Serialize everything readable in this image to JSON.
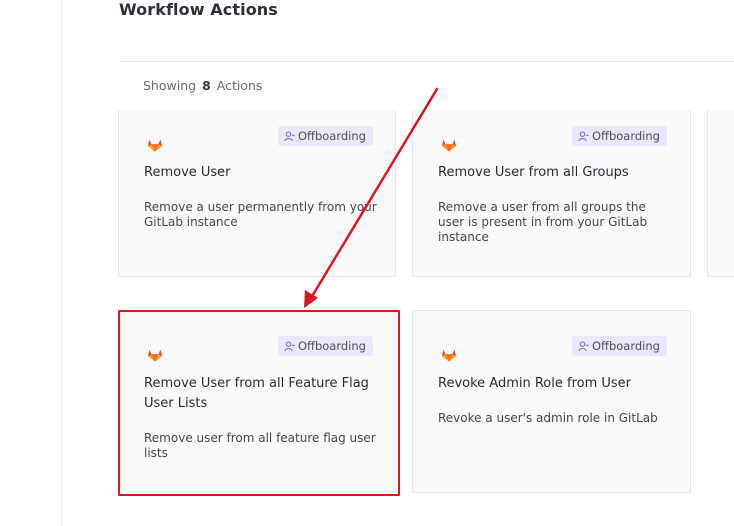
{
  "header": {
    "title": "Workflow Actions"
  },
  "summary": {
    "label": "Showing",
    "count": "8",
    "unit": "Actions"
  },
  "cards": [
    {
      "badge": "Offboarding",
      "title": "Remove User",
      "description": "Remove a user permanently from your GitLab instance",
      "logo": "gitlab-logo-icon"
    },
    {
      "badge": "Offboarding",
      "title": "Remove User from all Groups",
      "description": "Remove a user from all groups the user is present in from your GitLab instance",
      "logo": "gitlab-logo-icon"
    },
    {
      "badge": "Offboarding",
      "title": "Remove User from all Feature Flag User Lists",
      "description": "Remove user from all feature flag user lists",
      "logo": "gitlab-logo-icon"
    },
    {
      "badge": "Offboarding",
      "title": "Revoke Admin Role from User",
      "description": "Revoke a user's admin role in GitLab",
      "logo": "gitlab-logo-icon"
    }
  ],
  "colors": {
    "badge_bg": "#ebe8fb",
    "annotation": "#e0141c",
    "gitlab_orange": "#fc6d26"
  }
}
